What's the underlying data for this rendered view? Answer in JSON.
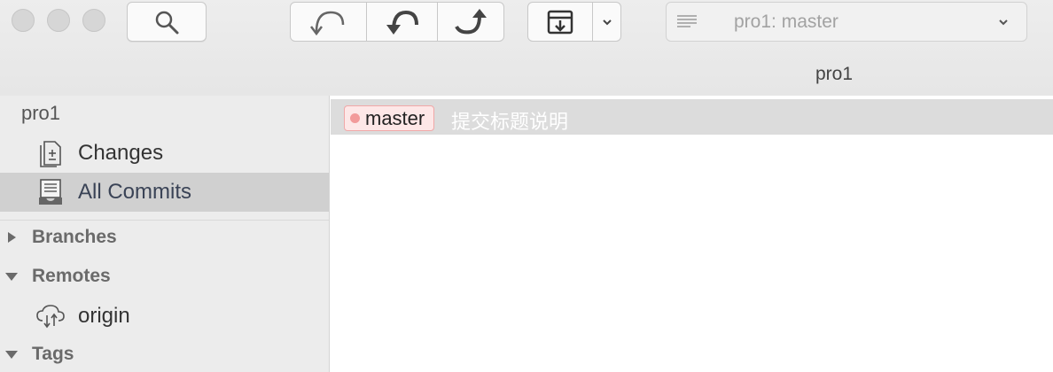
{
  "toolbar": {
    "repo_selector_label": "pro1: master",
    "window_title": "pro1"
  },
  "sidebar": {
    "repo_name": "pro1",
    "items": [
      {
        "label": "Changes",
        "icon": "changes-doc-icon"
      },
      {
        "label": "All Commits",
        "icon": "commits-stack-icon",
        "selected": true
      }
    ],
    "sections": [
      {
        "label": "Branches",
        "expanded": false
      },
      {
        "label": "Remotes",
        "expanded": true
      },
      {
        "label": "Tags",
        "expanded": true
      }
    ],
    "remotes": [
      {
        "label": "origin",
        "icon": "cloud-icon"
      }
    ]
  },
  "main": {
    "commit": {
      "branch_badge": "master",
      "message": "提交标题说明"
    }
  },
  "colors": {
    "badge_border": "#f0a8a8",
    "badge_fill": "#fde7e7",
    "selected_row": "#dcdcdc",
    "sidebar_bg": "#ececec"
  }
}
